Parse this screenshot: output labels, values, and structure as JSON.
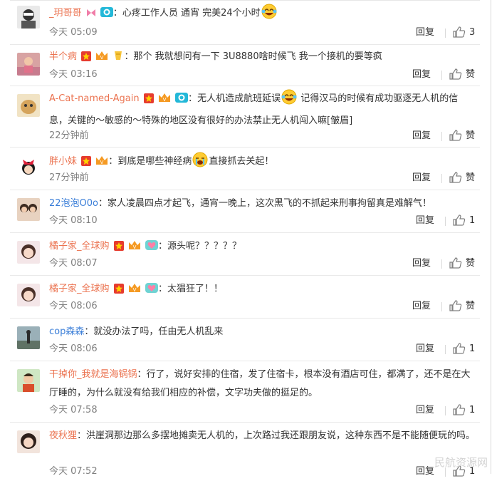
{
  "comments": [
    {
      "user": "_玥哥哥",
      "user_color": "#eb7350",
      "badges": [
        "ribbon-icon",
        "camera-icon"
      ],
      "text_before": "心疼工作人员 通宵 完美24个小时",
      "emoji": "laughing-tears-emoji",
      "text_after": "",
      "time": "今天 05:09",
      "reply": "回复",
      "likes": "3"
    },
    {
      "user": "半个病",
      "user_color": "#eb7350",
      "badges": [
        "star-badge-icon",
        "crown-badge-icon",
        "gold-badge-icon"
      ],
      "text_before": "那个 我就想问有一下 3U8880啥时候飞 我一个接机的要等疯",
      "emoji": "",
      "text_after": "",
      "time": "今天 03:16",
      "reply": "回复",
      "likes": "赞"
    },
    {
      "user": "A-Cat-named-Again",
      "user_color": "#eb7350",
      "badges": [
        "star-badge-icon",
        "crown-badge-icon",
        "camera-icon"
      ],
      "text_before": "无人机造成航班延误",
      "emoji": "laughing-tears-emoji",
      "text_after": " 记得汉马的时候有成功驱逐无人机的信息，关键的～敏感的～特殊的地区没有很好的办法禁止无人机闯入嘛[皱眉]",
      "time": "22分钟前",
      "reply": "回复",
      "likes": "赞"
    },
    {
      "user": "胖小妹",
      "user_color": "#eb7350",
      "badges": [
        "star-badge-icon",
        "crown-badge-icon"
      ],
      "text_before": "到底是哪些神经病",
      "emoji": "crying-emoji",
      "text_after": "直接抓去关起！",
      "time": "27分钟前",
      "reply": "回复",
      "likes": "赞"
    },
    {
      "user": "22泡泡O0o",
      "user_color": "#3a7ed8",
      "badges": [],
      "text_before": "家人凌晨四点才起飞，通宵一晚上，这次黑飞的不抓起来刑事拘留真是难解气！",
      "emoji": "",
      "text_after": "",
      "time": "今天 08:10",
      "reply": "回复",
      "likes": "1"
    },
    {
      "user": "橘子家_全球购",
      "user_color": "#eb7350",
      "badges": [
        "star-badge-icon",
        "crown-badge-icon",
        "heart-badge-icon"
      ],
      "text_before": "源头呢？？？？？",
      "emoji": "",
      "text_after": "",
      "time": "今天 08:07",
      "reply": "回复",
      "likes": "赞"
    },
    {
      "user": "橘子家_全球购",
      "user_color": "#eb7350",
      "badges": [
        "star-badge-icon",
        "crown-badge-icon",
        "heart-badge-icon"
      ],
      "text_before": "太猖狂了！！",
      "emoji": "",
      "text_after": "",
      "time": "今天 08:06",
      "reply": "回复",
      "likes": "赞"
    },
    {
      "user": "cop森森",
      "user_color": "#3a7ed8",
      "badges": [],
      "text_before": "就没办法了吗，任由无人机乱来",
      "emoji": "",
      "text_after": "",
      "time": "今天 08:06",
      "reply": "回复",
      "likes": "1"
    },
    {
      "user": "干掉你_我就是海锅锅",
      "user_color": "#eb7350",
      "badges": [],
      "text_before": "行了，说好安排的住宿，发了住宿卡，根本没有酒店可住，都满了，还不是在大厅睡的，为什么就没有给我们相应的补偿，文字功夫做的挺足的。",
      "emoji": "",
      "text_after": "",
      "time": "今天 07:58",
      "reply": "回复",
      "likes": "1"
    },
    {
      "user": "夜秋狸",
      "user_color": "#eb7350",
      "badges": [],
      "text_before": "洪崖洞那边那么多摆地摊卖无人机的，上次路过我还跟朋友说，这种东西不是不能随便玩的吗。",
      "emoji": "",
      "text_after": "",
      "time": "今天 07:52",
      "reply": "回复",
      "likes": "1"
    }
  ],
  "watermark": "民航资源网"
}
